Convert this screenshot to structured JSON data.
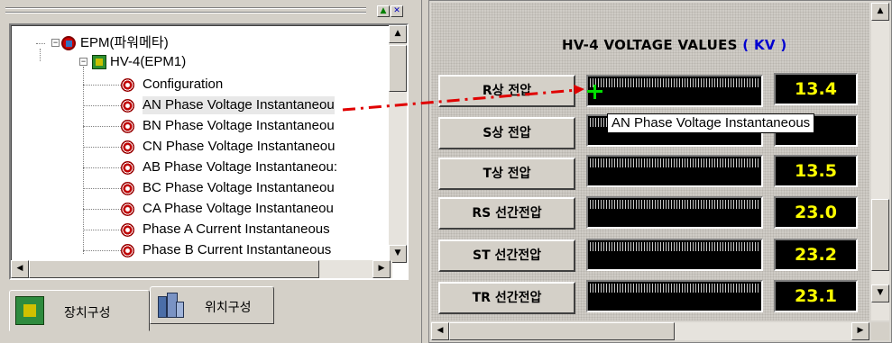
{
  "left_panel": {
    "tree": {
      "items": [
        {
          "label": "EPM(파워메타)",
          "level": 0,
          "icon": "epm-icon"
        },
        {
          "label": "HV-4(EPM1)",
          "level": 1,
          "icon": "hv-device-icon"
        },
        {
          "label": "Configuration",
          "level": 2,
          "icon": "point-icon"
        },
        {
          "label": "AN Phase Voltage Instantaneou",
          "level": 2,
          "icon": "point-icon",
          "selected": true
        },
        {
          "label": "BN Phase Voltage Instantaneou",
          "level": 2,
          "icon": "point-icon"
        },
        {
          "label": "CN Phase Voltage Instantaneou",
          "level": 2,
          "icon": "point-icon"
        },
        {
          "label": "AB Phase Voltage Instantaneou:",
          "level": 2,
          "icon": "point-icon"
        },
        {
          "label": "BC Phase Voltage Instantaneou",
          "level": 2,
          "icon": "point-icon"
        },
        {
          "label": "CA Phase Voltage Instantaneou",
          "level": 2,
          "icon": "point-icon"
        },
        {
          "label": "Phase A Current Instantaneous",
          "level": 2,
          "icon": "point-icon"
        },
        {
          "label": "Phase B Current Instantaneous",
          "level": 2,
          "icon": "point-icon"
        }
      ]
    },
    "tabs": [
      {
        "label": "장치구성",
        "icon": "device-config-icon",
        "active": true
      },
      {
        "label": "위치구성",
        "icon": "building-icon",
        "active": false
      }
    ]
  },
  "right_panel": {
    "title": "HV-4 VOLTAGE VALUES",
    "unit": "( KV )",
    "rows": [
      {
        "label": "R상 전압",
        "value": "13.4"
      },
      {
        "label": "S상 전압",
        "value": ""
      },
      {
        "label": "T상 전압",
        "value": "13.5"
      },
      {
        "label": "RS 선간전압",
        "value": "23.0"
      },
      {
        "label": "ST 선간전압",
        "value": "23.2"
      },
      {
        "label": "TR 선간전압",
        "value": "23.1"
      }
    ],
    "tooltip": "AN Phase Voltage Instantaneous"
  },
  "colors": {
    "value_text": "#ffff00",
    "unit_text": "#0000d0",
    "drag_arrow": "#e00000",
    "drop_cursor": "#00e000"
  }
}
